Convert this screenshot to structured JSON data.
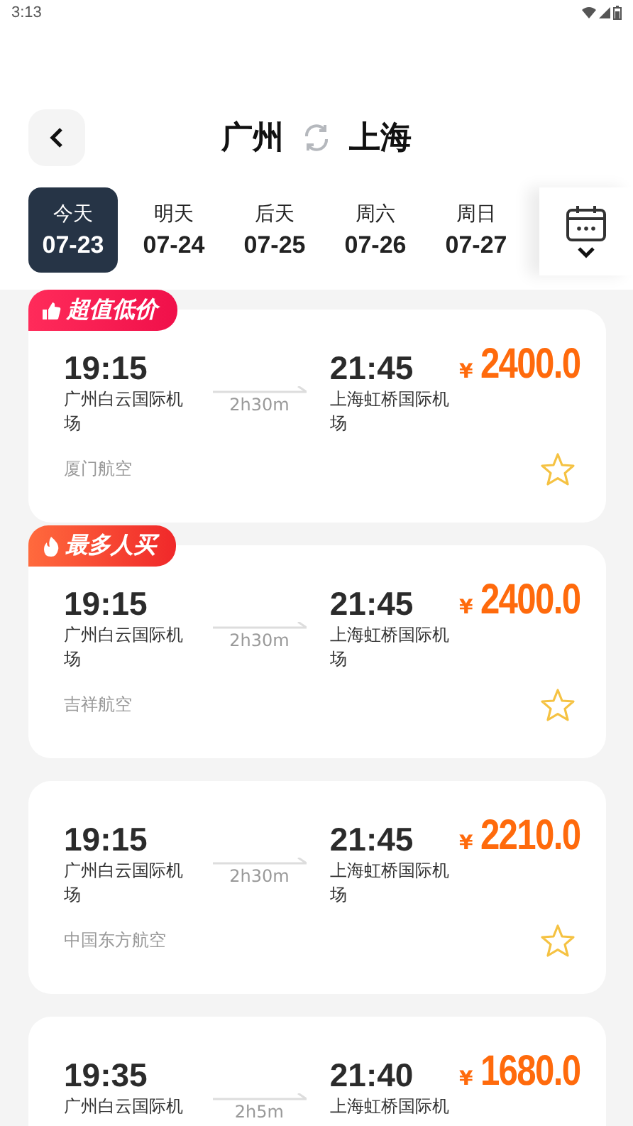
{
  "status_bar": {
    "time": "3:13"
  },
  "header": {
    "from": "广州",
    "to": "上海"
  },
  "dates": [
    {
      "weekday": "今天",
      "date": "07-23",
      "selected": true
    },
    {
      "weekday": "明天",
      "date": "07-24",
      "selected": false
    },
    {
      "weekday": "后天",
      "date": "07-25",
      "selected": false
    },
    {
      "weekday": "周六",
      "date": "07-26",
      "selected": false
    },
    {
      "weekday": "周日",
      "date": "07-27",
      "selected": false
    }
  ],
  "flights": [
    {
      "badge": {
        "kind": "value",
        "label": "超值低价"
      },
      "depart_time": "19:15",
      "depart_airport": "广州白云国际机场",
      "duration": "2h30m",
      "arrive_time": "21:45",
      "arrive_airport": "上海虹桥国际机场",
      "currency": "¥",
      "price": "2400.0",
      "airline": "厦门航空",
      "favorited": false
    },
    {
      "badge": {
        "kind": "popular",
        "label": "最多人买"
      },
      "depart_time": "19:15",
      "depart_airport": "广州白云国际机场",
      "duration": "2h30m",
      "arrive_time": "21:45",
      "arrive_airport": "上海虹桥国际机场",
      "currency": "¥",
      "price": "2400.0",
      "airline": "吉祥航空",
      "favorited": false
    },
    {
      "depart_time": "19:15",
      "depart_airport": "广州白云国际机场",
      "duration": "2h30m",
      "arrive_time": "21:45",
      "arrive_airport": "上海虹桥国际机场",
      "currency": "¥",
      "price": "2210.0",
      "airline": "中国东方航空",
      "favorited": false
    },
    {
      "depart_time": "19:35",
      "depart_airport": "广州白云国际机",
      "duration": "2h5m",
      "arrive_time": "21:40",
      "arrive_airport": "上海虹桥国际机",
      "currency": "¥",
      "price": "1680.0"
    }
  ]
}
